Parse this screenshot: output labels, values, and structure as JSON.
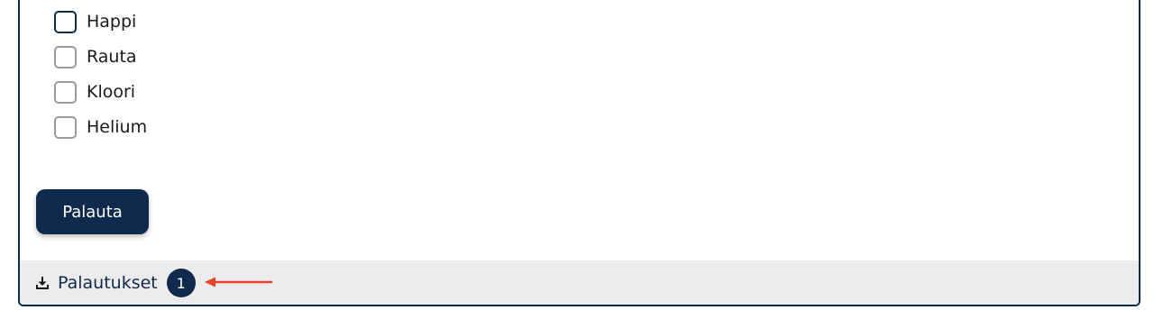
{
  "question": {
    "options": [
      {
        "label": "Happi",
        "checked": false,
        "focused": true
      },
      {
        "label": "Rauta",
        "checked": false,
        "focused": false
      },
      {
        "label": "Kloori",
        "checked": false,
        "focused": false
      },
      {
        "label": "Helium",
        "checked": false,
        "focused": false
      }
    ],
    "submit_label": "Palauta"
  },
  "footer": {
    "submissions_label": "Palautukset",
    "submissions_count": "1",
    "icon": "download-icon"
  },
  "colors": {
    "primary": "#0f2a4d",
    "footer_bg": "#ececec",
    "annotation_arrow": "#e8432a",
    "checkbox_border": "#9a9a9a"
  }
}
